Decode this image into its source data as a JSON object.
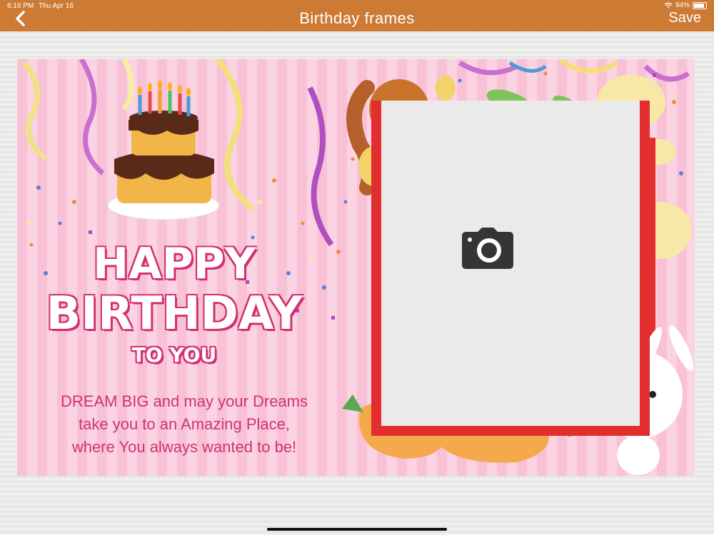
{
  "status_bar": {
    "time": "6:16 PM",
    "date": "Thu Apr 16",
    "battery": "94%"
  },
  "nav": {
    "title": "Birthday frames",
    "save_label": "Save"
  },
  "card": {
    "headline_1": "HAPPY",
    "headline_2": "BIRTHDAY",
    "headline_3": "TO YOU",
    "message_line_1": "DREAM BIG and may your Dreams",
    "message_line_2": "take you to an Amazing Place,",
    "message_line_3": "where You always wanted to be!"
  },
  "icons": {
    "back": "chevron-left-icon",
    "camera": "camera-icon"
  },
  "colors": {
    "nav_bar": "#cd7a34",
    "frame_red": "#e22e2e",
    "text_pink": "#d0336f"
  }
}
